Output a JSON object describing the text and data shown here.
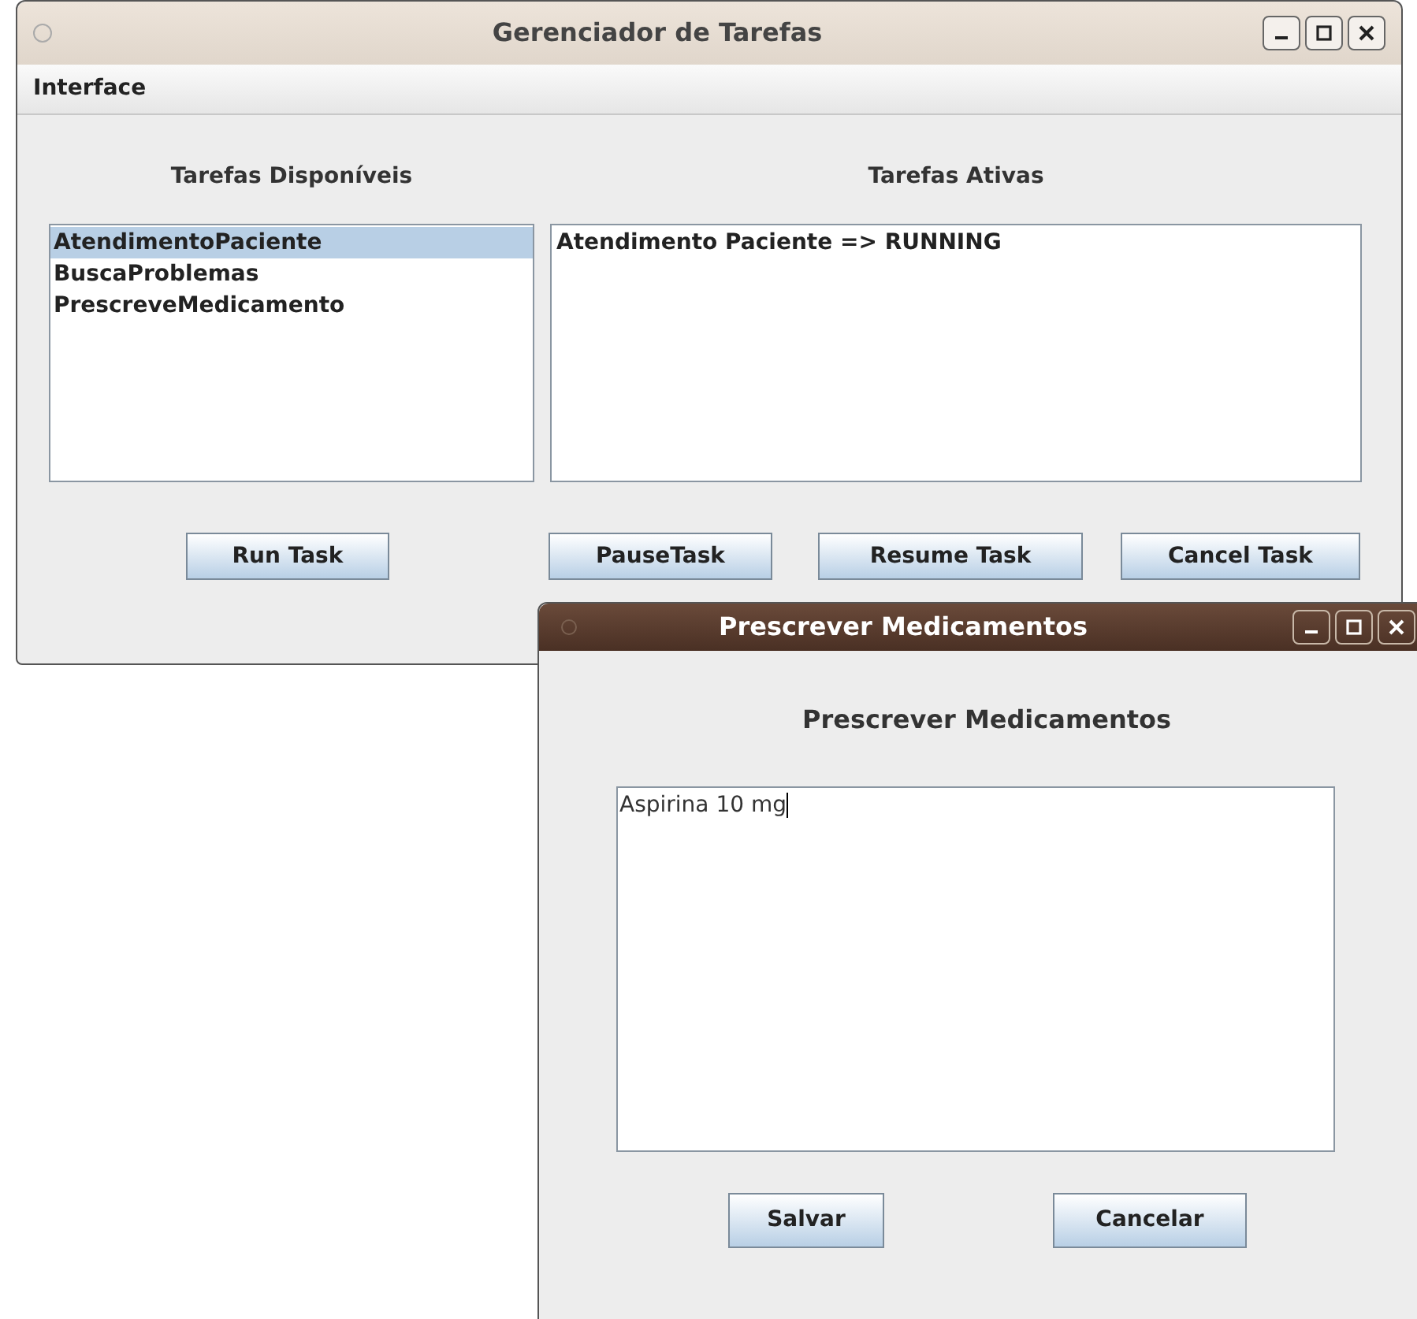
{
  "main_window": {
    "title": "Gerenciador de Tarefas",
    "menu": [
      "Interface"
    ],
    "available": {
      "heading": "Tarefas Disponíveis",
      "items": [
        {
          "label": "AtendimentoPaciente",
          "selected": true
        },
        {
          "label": "BuscaProblemas",
          "selected": false
        },
        {
          "label": "PrescreveMedicamento",
          "selected": false
        }
      ]
    },
    "active": {
      "heading": "Tarefas Ativas",
      "items": [
        "Atendimento Paciente => RUNNING"
      ]
    },
    "buttons": [
      "Run Task",
      "PauseTask",
      "Resume Task",
      "Cancel Task"
    ]
  },
  "dialog": {
    "title": "Prescrever Medicamentos",
    "heading": "Prescrever Medicamentos",
    "text": "Aspirina 10 mg",
    "buttons": [
      "Salvar",
      "Cancelar"
    ]
  }
}
